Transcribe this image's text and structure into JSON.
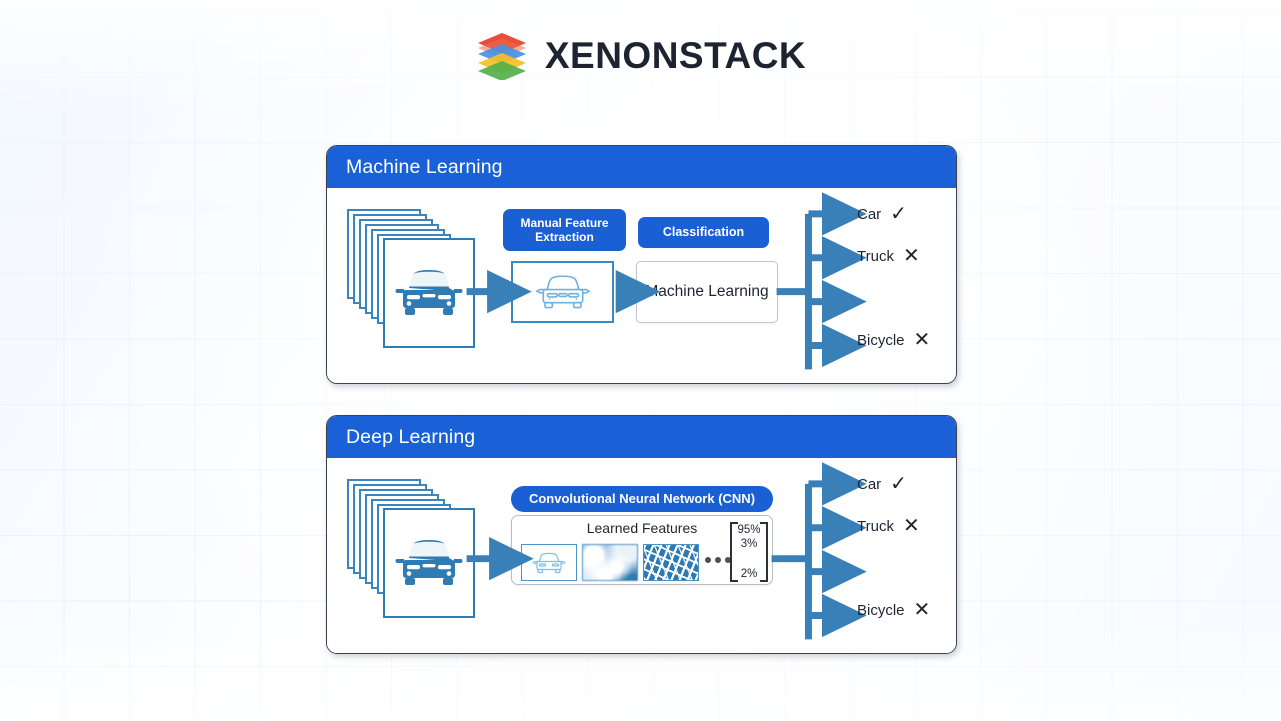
{
  "brand": {
    "name": "XENONSTACK",
    "logo_icon": "stacked-layers-logo-icon",
    "logo_colors": [
      "#e8442e",
      "#4a90e2",
      "#f5c024",
      "#52b04a"
    ]
  },
  "theme": {
    "header_blue": "#1a60d6",
    "badge_blue": "#1a5fd4",
    "arrow_blue": "#3a80b8",
    "outline_blue": "#3c84bd",
    "text_dark": "#1f2530",
    "grid_line": "#96b9f0"
  },
  "panels": [
    {
      "id": "machine-learning",
      "title": "Machine Learning",
      "stack": {
        "icon": "car-image-stack-icon",
        "card_count": 7
      },
      "badges": [
        {
          "id": "manual-feature-extraction",
          "label": "Manual Feature Extraction"
        },
        {
          "id": "classification",
          "label": "Classification"
        }
      ],
      "feature_box": {
        "icon": "car-outline-icon"
      },
      "model_box": {
        "label": "Machine Learning"
      },
      "outputs": [
        {
          "label": "Car",
          "mark": "check",
          "mark_glyph": "✓"
        },
        {
          "label": "Truck",
          "mark": "cross",
          "mark_glyph": "✕"
        },
        {
          "label": "",
          "mark": "none",
          "mark_glyph": ""
        },
        {
          "label": "Bicycle",
          "mark": "cross",
          "mark_glyph": "✕"
        }
      ]
    },
    {
      "id": "deep-learning",
      "title": "Deep Learning",
      "stack": {
        "icon": "car-image-stack-icon",
        "card_count": 7
      },
      "badges": [
        {
          "id": "cnn",
          "label": "Convolutional Neural Network (CNN)"
        }
      ],
      "cnn_box": {
        "title": "Learned Features",
        "feature_maps": [
          {
            "id": "feature-map-car-outline",
            "kind": "car-outline"
          },
          {
            "id": "feature-map-blurred-blobs",
            "kind": "blob-texture"
          },
          {
            "id": "feature-map-speckles",
            "kind": "speckle-texture"
          }
        ],
        "ellipsis": "•••",
        "probabilities": [
          "95%",
          "3%",
          "2%"
        ]
      },
      "outputs": [
        {
          "label": "Car",
          "mark": "check",
          "mark_glyph": "✓"
        },
        {
          "label": "Truck",
          "mark": "cross",
          "mark_glyph": "✕"
        },
        {
          "label": "",
          "mark": "none",
          "mark_glyph": ""
        },
        {
          "label": "Bicycle",
          "mark": "cross",
          "mark_glyph": "✕"
        }
      ]
    }
  ]
}
